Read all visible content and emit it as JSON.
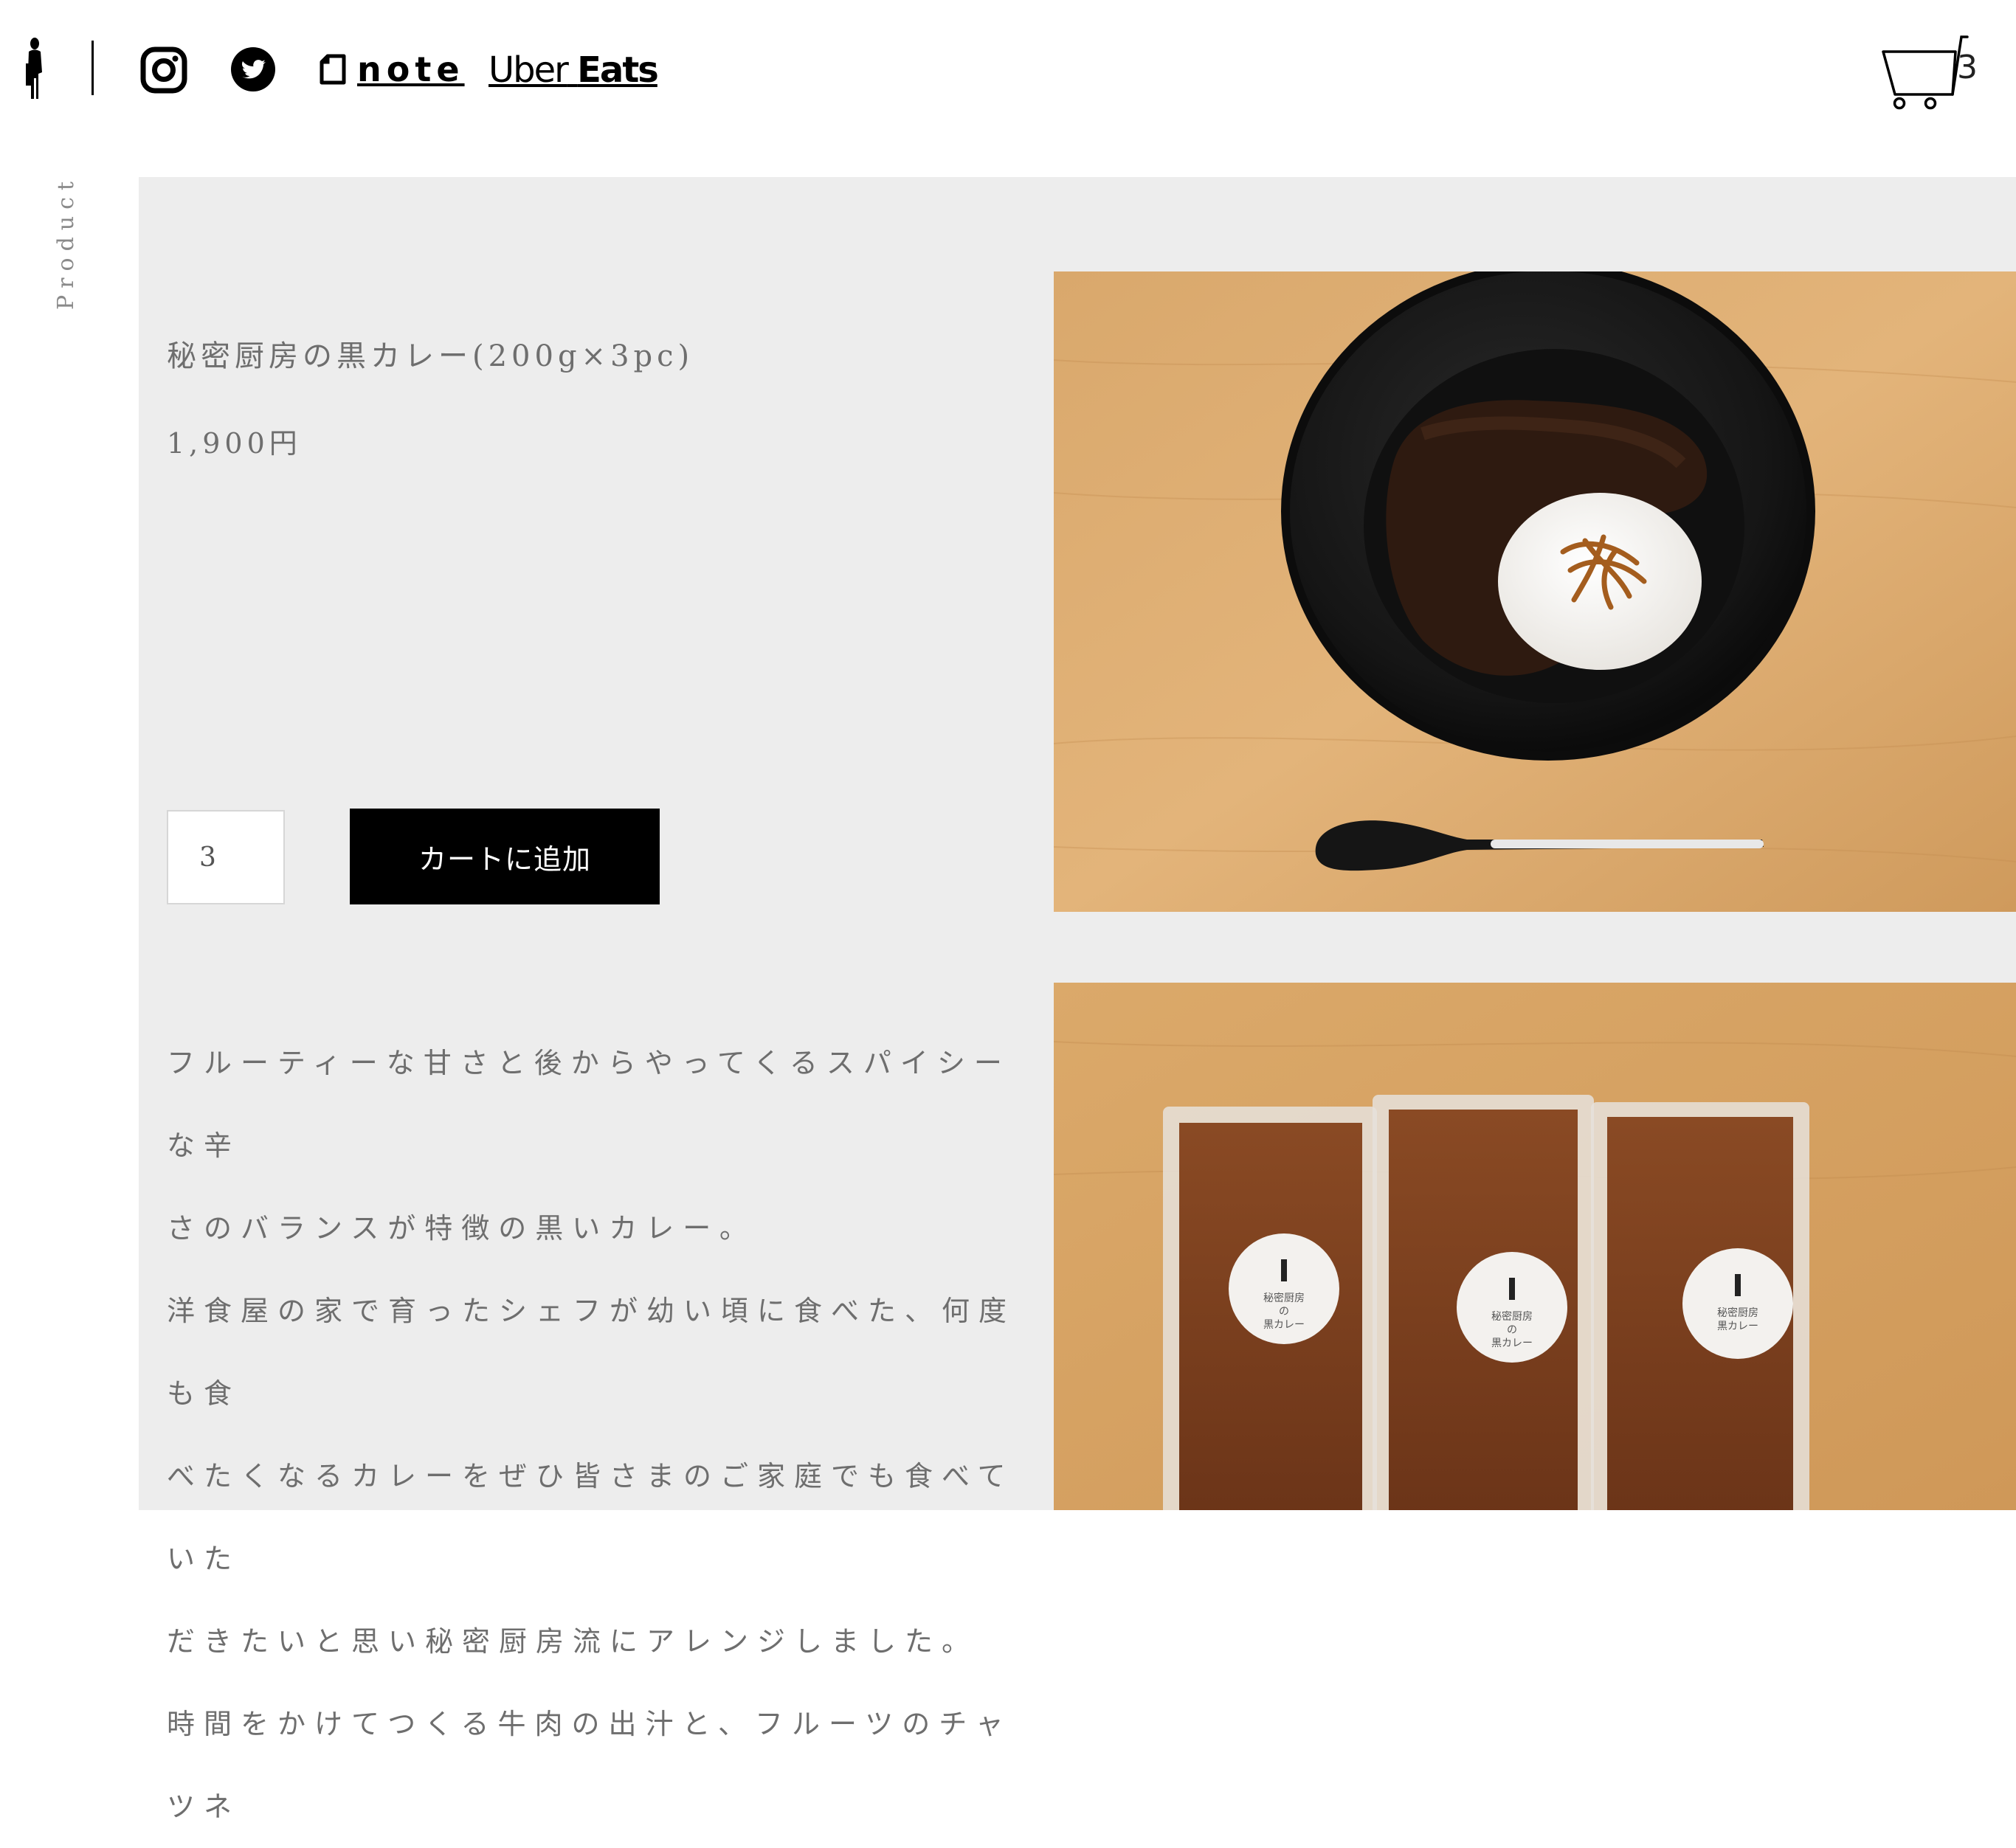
{
  "header": {
    "logo": "chef-silhouette-logo",
    "links": {
      "instagram": "instagram-icon",
      "twitter": "twitter-icon",
      "note_label": "note",
      "uber_label_1": "Uber",
      "uber_label_2": "Eats"
    },
    "cart_count": "3"
  },
  "side_label": "Product",
  "product": {
    "title": "秘密厨房の黒カレー(200g×3pc)",
    "price": "1,900円",
    "quantity_value": "3",
    "add_to_cart_label": "カートに追加",
    "description_lines": [
      "フルーティーな甘さと後からやってくるスパイシーな辛",
      "さのバランスが特徴の黒いカレー。",
      "洋食屋の家で育ったシェフが幼い頃に食べた、何度も食",
      "べたくなるカレーをぜひ皆さまのご家庭でも食べていた",
      "だきたいと思い秘密厨房流にアレンジしました。",
      "時間をかけてつくる牛肉の出汁と、フルーツのチャツネ"
    ]
  },
  "images": {
    "main_photo": "curry-plate-photo",
    "pack_photo": "curry-packs-photo",
    "pack_sticker_lines": [
      "秘密厨房",
      "の",
      "黒カレー"
    ]
  },
  "colors": {
    "panel_bg": "#ededed",
    "button_bg": "#000000",
    "button_text": "#ffffff",
    "text": "#6e6e6e",
    "wood": "#d6a46a"
  }
}
